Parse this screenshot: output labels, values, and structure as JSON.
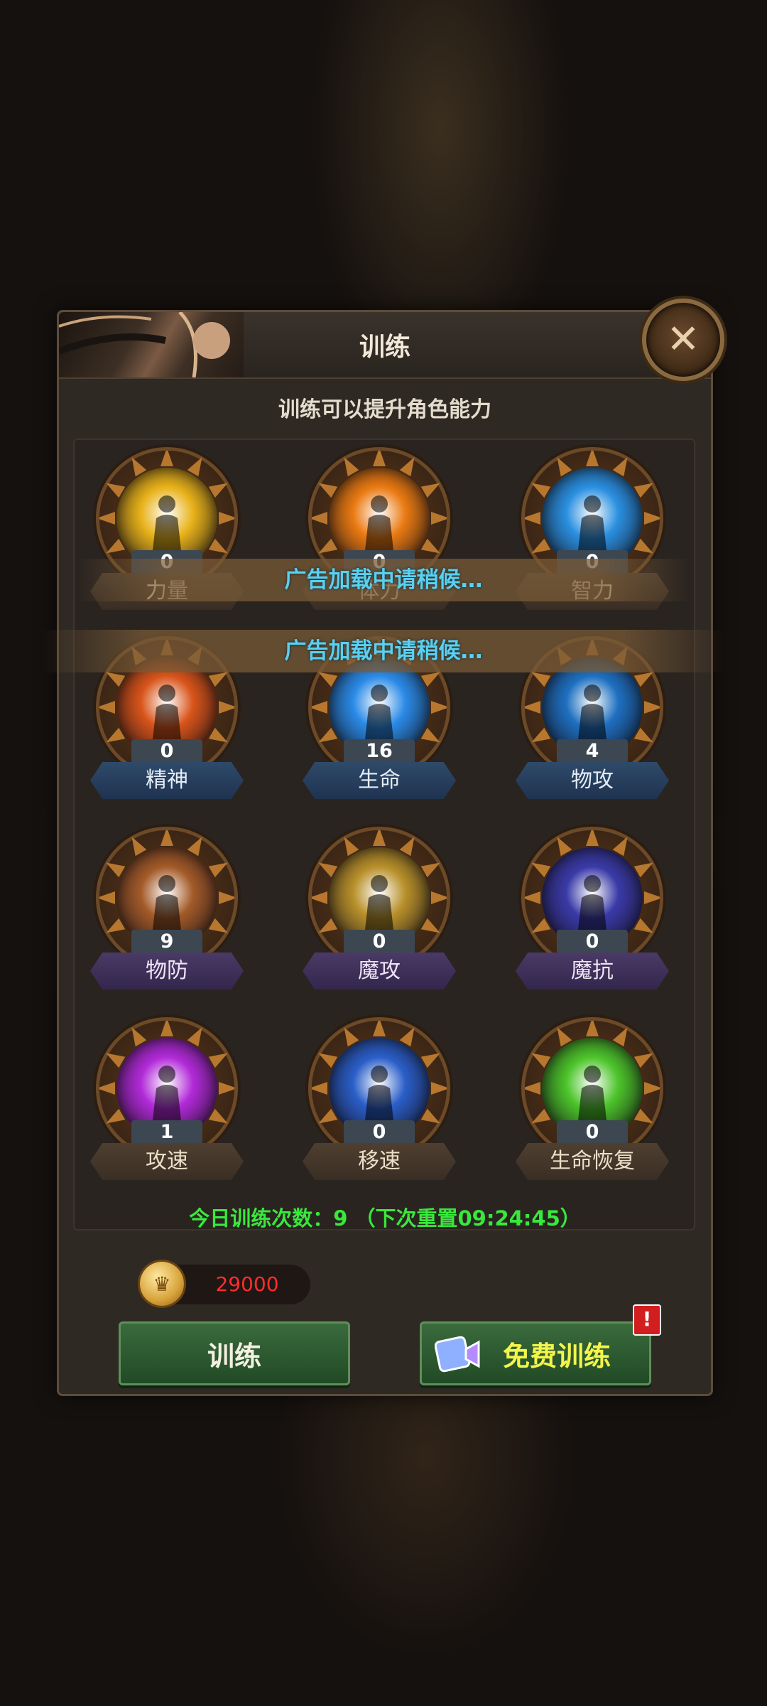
{
  "dialog": {
    "title": "训练",
    "subtitle": "训练可以提升角色能力",
    "close_icon": "close-icon"
  },
  "stats": [
    {
      "label": "力量",
      "value": "0",
      "icon": "strength-icon",
      "orb_color": "#e8b21a",
      "plate": "brown"
    },
    {
      "label": "体力",
      "value": "0",
      "icon": "stamina-sword-icon",
      "orb_color": "#ea7a12",
      "plate": "brown"
    },
    {
      "label": "智力",
      "value": "0",
      "icon": "intellect-swirl-icon",
      "orb_color": "#2a8fe0",
      "plate": "brown"
    },
    {
      "label": "精神",
      "value": "0",
      "icon": "spirit-shield-icon",
      "orb_color": "#d8541a",
      "plate": "blue"
    },
    {
      "label": "生命",
      "value": "16",
      "icon": "life-shield-icon",
      "orb_color": "#2a8ae6",
      "plate": "blue"
    },
    {
      "label": "物攻",
      "value": "4",
      "icon": "physical-attack-icon",
      "orb_color": "#1e6fc0",
      "plate": "blue"
    },
    {
      "label": "物防",
      "value": "9",
      "icon": "physical-defense-fist-icon",
      "orb_color": "#a35a28",
      "plate": "purple"
    },
    {
      "label": "魔攻",
      "value": "0",
      "icon": "magic-attack-icon",
      "orb_color": "#b8902a",
      "plate": "purple"
    },
    {
      "label": "魔抗",
      "value": "0",
      "icon": "magic-resist-icon",
      "orb_color": "#3a3aa8",
      "plate": "purple"
    },
    {
      "label": "攻速",
      "value": "1",
      "icon": "attack-speed-icon",
      "orb_color": "#b12ad8",
      "plate": "brown"
    },
    {
      "label": "移速",
      "value": "0",
      "icon": "move-speed-icon",
      "orb_color": "#2a5ec8",
      "plate": "brown"
    },
    {
      "label": "生命恢复",
      "value": "0",
      "icon": "regen-icon",
      "orb_color": "#4cc42a",
      "plate": "brown"
    }
  ],
  "ad_banners": [
    "广告加载中请稍候…",
    "广告加载中请稍候…"
  ],
  "daily_info": "今日训练次数：9 （下次重置09:24:45）",
  "currency": {
    "amount": "29000",
    "icon": "gold-coin-icon"
  },
  "buttons": {
    "train_label": "训练",
    "free_train_label": "免费训练",
    "alert_badge": "!"
  }
}
